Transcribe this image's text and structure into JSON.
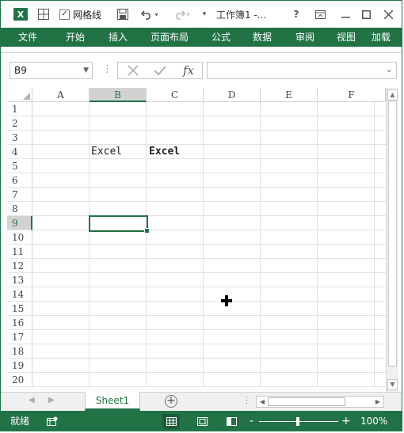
{
  "titlebar": {
    "app_logo": "X",
    "gridlines_checked": true,
    "gridlines_label": "网格线",
    "title": "工作簿1 -...",
    "help": "?",
    "icons": [
      "excel-logo",
      "table-icon",
      "save-icon",
      "undo-icon",
      "redo-icon",
      "customize-qat-icon",
      "help-icon",
      "ribbon-display-icon",
      "minimize-icon",
      "maximize-icon",
      "close-icon"
    ]
  },
  "ribbon": {
    "tabs": [
      "文件",
      "开始",
      "插入",
      "页面布局",
      "公式",
      "数据",
      "审阅",
      "视图",
      "加载"
    ]
  },
  "formula_bar": {
    "name_box": "B9",
    "formula_value": ""
  },
  "sheet": {
    "columns": [
      "A",
      "B",
      "C",
      "D",
      "E",
      "F"
    ],
    "rows": [
      "1",
      "2",
      "3",
      "4",
      "5",
      "6",
      "7",
      "8",
      "9",
      "10",
      "11",
      "12",
      "13",
      "14",
      "15",
      "16",
      "17",
      "18",
      "19",
      "20"
    ],
    "selected_cell": "B9",
    "selected_column": "B",
    "selected_row": "9",
    "cells": [
      {
        "ref": "B4",
        "value": "Excel",
        "bold": false
      },
      {
        "ref": "C4",
        "value": "Excel",
        "bold": true
      }
    ]
  },
  "sheet_tabs": {
    "tabs": [
      "Sheet1"
    ],
    "active": "Sheet1"
  },
  "status_bar": {
    "mode": "就绪",
    "zoom": "100%",
    "zoom_minus": "-",
    "zoom_plus": "+"
  },
  "colors": {
    "accent": "#217346",
    "header_selected_bg": "#d2d2d2",
    "gridline": "#e1e1e1"
  }
}
